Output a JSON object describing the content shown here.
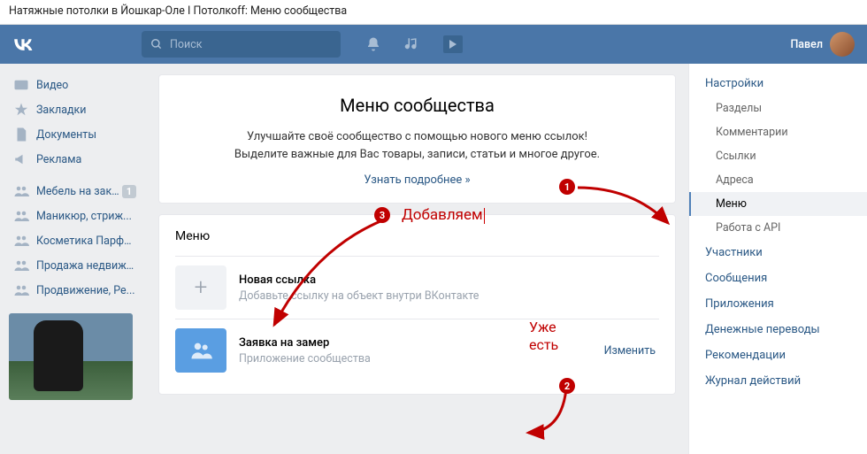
{
  "browser_title": "Натяжные потолки в Йошкар-Оле I Потолкоff: Меню сообщества",
  "search": {
    "placeholder": "Поиск"
  },
  "user": {
    "name": "Павел"
  },
  "left_nav": {
    "items": [
      {
        "icon": "video",
        "label": "Видео"
      },
      {
        "icon": "star",
        "label": "Закладки"
      },
      {
        "icon": "doc",
        "label": "Документы"
      },
      {
        "icon": "horn",
        "label": "Реклама"
      }
    ],
    "groups": [
      {
        "label": "Мебель на зака...",
        "badge": "1"
      },
      {
        "label": "Маникюр, стриж..."
      },
      {
        "label": "Косметика Парфю..."
      },
      {
        "label": "Продажа недвижи..."
      },
      {
        "label": "Продвижение, Ре..."
      }
    ]
  },
  "intro": {
    "title": "Меню сообщества",
    "line1": "Улучшайте своё сообщество с помощью нового меню ссылок!",
    "line2": "Выделите важные для Вас товары, записи, статьи и многое другое.",
    "link": "Узнать подробнее »"
  },
  "menu": {
    "title": "Меню",
    "rows": [
      {
        "title": "Новая ссылка",
        "sub": "Добавьте ссылку на объект внутри ВКонтакте"
      },
      {
        "title": "Заявка на замер",
        "sub": "Приложение сообщества",
        "action": "Изменить"
      }
    ]
  },
  "right_nav": {
    "sections": [
      {
        "head": "Настройки",
        "items": [
          "Разделы",
          "Комментарии",
          "Ссылки",
          "Адреса",
          "Меню",
          "Работа с API"
        ],
        "active_index": 4
      },
      {
        "head": "Участники"
      },
      {
        "head": "Сообщения"
      },
      {
        "head": "Приложения"
      },
      {
        "head": "Денежные переводы"
      },
      {
        "head": "Рекомендации"
      },
      {
        "head": "Журнал действий"
      }
    ]
  },
  "annotations": {
    "add_label": "Добавляем",
    "exists_label": "Уже есть",
    "markers": [
      "1",
      "2",
      "3"
    ]
  }
}
